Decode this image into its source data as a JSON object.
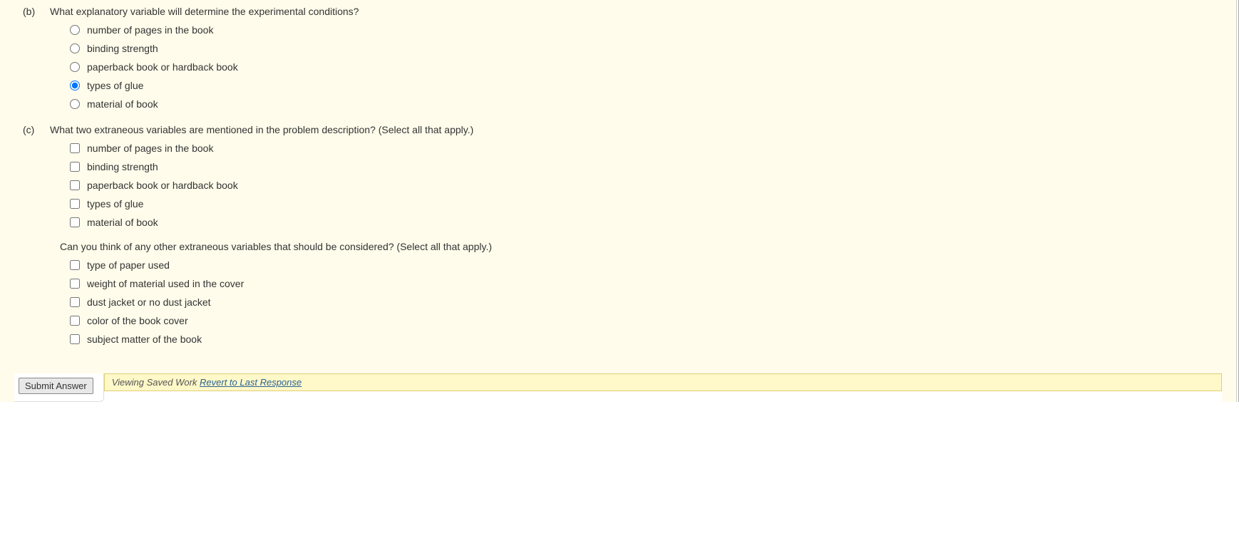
{
  "partB": {
    "label": "(b)",
    "question": "What explanatory variable will determine the experimental conditions?",
    "options": [
      {
        "text": "number of pages in the book",
        "selected": false
      },
      {
        "text": "binding strength",
        "selected": false
      },
      {
        "text": "paperback book or hardback book",
        "selected": false
      },
      {
        "text": "types of glue",
        "selected": true
      },
      {
        "text": "material of book",
        "selected": false
      }
    ]
  },
  "partC": {
    "label": "(c)",
    "question": "What two extraneous variables are mentioned in the problem description? (Select all that apply.)",
    "options1": [
      {
        "text": "number of pages in the book"
      },
      {
        "text": "binding strength"
      },
      {
        "text": "paperback book or hardback book"
      },
      {
        "text": "types of glue"
      },
      {
        "text": "material of book"
      }
    ],
    "subQuestion": "Can you think of any other extraneous variables that should be considered? (Select all that apply.)",
    "options2": [
      {
        "text": "type of paper used"
      },
      {
        "text": "weight of material used in the cover"
      },
      {
        "text": "dust jacket or no dust jacket"
      },
      {
        "text": "color of the book cover"
      },
      {
        "text": "subject matter of the book"
      }
    ]
  },
  "footer": {
    "submitLabel": "Submit Answer",
    "savedWorkText": "Viewing Saved Work ",
    "revertText": "Revert to Last Response"
  }
}
